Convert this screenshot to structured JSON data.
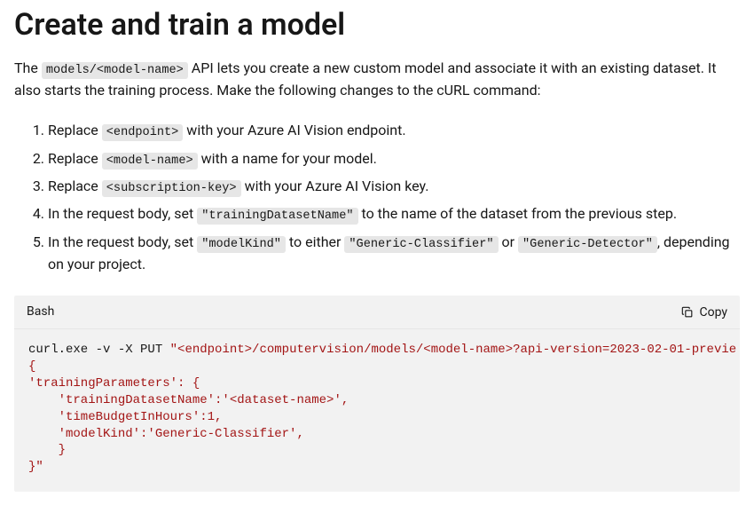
{
  "heading": "Create and train a model",
  "intro": {
    "pre": "The ",
    "api_code": "models/<model-name>",
    "post": " API lets you create a new custom model and associate it with an existing dataset. It also starts the training process. Make the following changes to the cURL command:"
  },
  "steps": [
    {
      "pre": "Replace ",
      "code": "<endpoint>",
      "post": " with your Azure AI Vision endpoint."
    },
    {
      "pre": "Replace ",
      "code": "<model-name>",
      "post": " with a name for your model."
    },
    {
      "pre": "Replace ",
      "code": "<subscription-key>",
      "post": " with your Azure AI Vision key."
    },
    {
      "pre": "In the request body, set ",
      "code": "\"trainingDatasetName\"",
      "post": " to the name of the dataset from the previous step."
    }
  ],
  "step5": {
    "pre": "In the request body, set ",
    "code1": "\"modelKind\"",
    "mid1": " to either ",
    "code2": "\"Generic-Classifier\"",
    "mid2": " or ",
    "code3": "\"Generic-Detector\"",
    "post": ", depending on your project."
  },
  "codeblock": {
    "lang": "Bash",
    "copy_label": "Copy",
    "cmd": "curl.exe -v -X PUT ",
    "str_line1": "\"<endpoint>/computervision/models/<model-name>?api-version=2023-02-01-previe",
    "str_lines": "{\n'trainingParameters': {\n    'trainingDatasetName':'<dataset-name>',\n    'timeBudgetInHours':1,\n    'modelKind':'Generic-Classifier',\n    }\n}\""
  }
}
